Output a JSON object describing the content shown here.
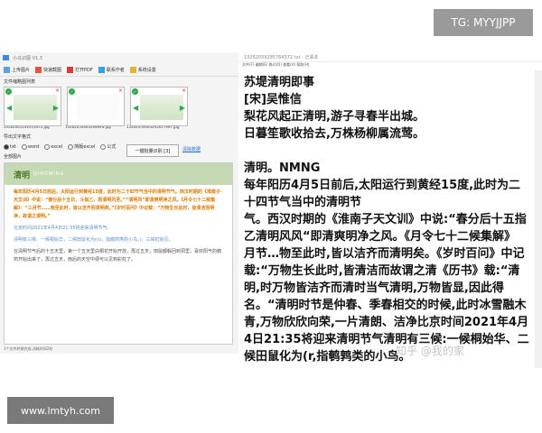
{
  "badge_top": "TG: MYYJJPP",
  "badge_bottom": "www.lmtyh.com",
  "app": {
    "title": "小马识图 V1.3",
    "toolbar": [
      "上传图片",
      "快速截图",
      "打开PDF",
      "联系作者",
      "系统设置"
    ],
    "images_label": "文件缩略图列表",
    "files": [
      "13262065192953472.jpg",
      "13262059463298946.jpg",
      "13262059463265617997.jpg"
    ],
    "mode_label": "导出文字格式",
    "modes": [
      "txt",
      "word",
      "excel",
      "简版excel",
      "公式"
    ],
    "recognize_button": "一键批量识别 [3]",
    "clear_link": "清除数据",
    "result_label": "全部图片",
    "doc_title": "清明",
    "doc_title_pinyin": "QINGMING",
    "doc_paragraphs": [
      "每年阳历4月5日前后，太阳运行到黄经15度，此时为二十四节气当中的清明节气。西汉时期的《淮南子·天文训》中说：“春分后十五日，斗指乙，则清明风至。”“清明风”即清爽明净之风。《月令七十二候集解》：“三月节……物至此时，皆以洁齐而清明矣。”《岁时百问》中记载：“万物生长此时，皆清洁而明净，故谓之清明。”",
      "北京时间2021年4月4日21:35将迎来清明节气。",
      "清明有三候：一候桐始华，二候田鼠化为(rú，指鹌鹑类的小鸟。)，三候虹始见。",
      "在清明节气后的十五天里，第一个五天里白桐花开始开放，再过五天，田鼠都躲回到洞里，喜欢阳气的鹌鹑开始出来了，再过五天，雨后的天空中便可以见到彩虹了。"
    ],
    "status": "3个文件转换完成,消耗时间2秒"
  },
  "notepad": {
    "title": "13262059295764372.txt - 记事本",
    "menu": "文件(F)  编辑(E)  格式(O)  查看(V)  帮助(H)",
    "text": "苏堤清明即事\n[宋]吴惟信\n梨花风起正清明,游子寻春半出城。\n日暮笙歌收拾去,万株杨柳属流莺。\n\n清明。NMNG\n每年阳历4月5日前后,太阳运行到黄经15度,此时为二十四节气当中的清明节\n气。西汉时期的《淮南子天文训》中说:“春分后十五指乙清明风风“即清爽明净之风。《月令七十二候集解》\n月节…物至此时,皆以洁齐而清明矣。《岁时百问》中记载:“万物生长此时,皆清洁而故谓之清《历书》载:“清明,时万物皆洁齐而清时当气清明,万物皆显,因此得名。“清明时节是仲春、季春相交的时候,此时冰雪融木青,万物欣欣向荣,一片清朗、洁净比京时间2021年4月4日21:35将迎来清明节气清明有三候:一候桐始华、二候田鼠化为(r,指鹌鹑类的小鸟。"
  },
  "watermark": "知乎 @我的家"
}
